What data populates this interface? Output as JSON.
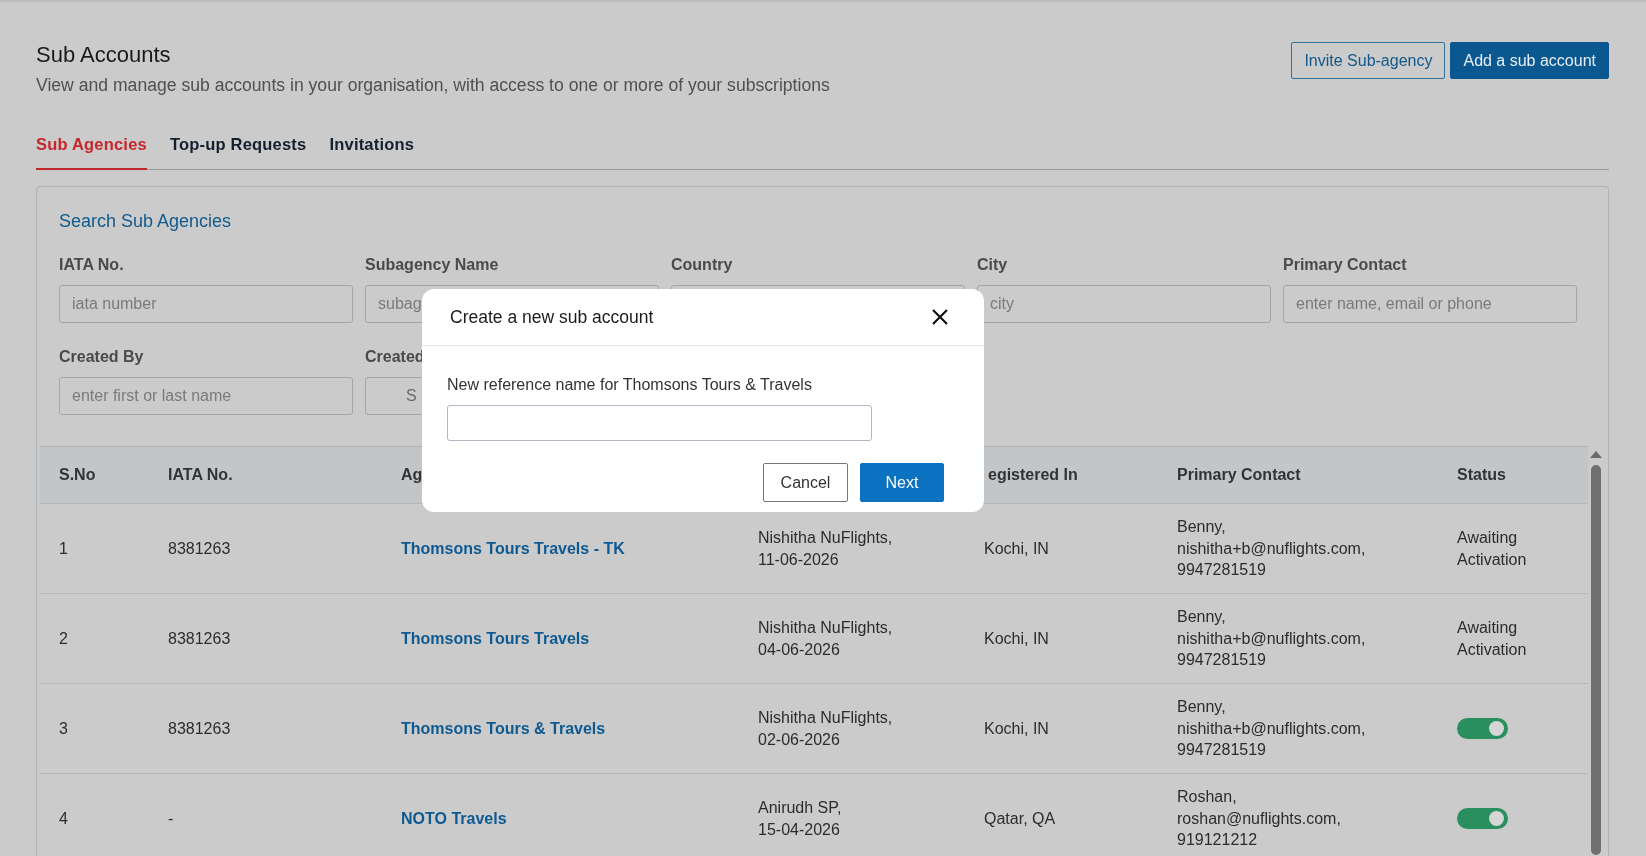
{
  "page": {
    "title": "Sub Accounts",
    "subtitle": "View and manage sub accounts in your organisation, with access to one or more of your subscriptions"
  },
  "header_buttons": [
    {
      "label": "Invite Sub-agency",
      "kind": "outline"
    },
    {
      "label": "Add a sub account",
      "kind": "primary"
    }
  ],
  "tabs": [
    {
      "label": "Sub Agencies",
      "selected": true
    },
    {
      "label": "Top-up Requests",
      "selected": false
    },
    {
      "label": "Invitations",
      "selected": false
    }
  ],
  "search": {
    "title": "Search Sub Agencies",
    "fields": [
      {
        "label": "IATA No.",
        "placeholder": "iata number"
      },
      {
        "label": "Subagency Name",
        "placeholder": "subag"
      },
      {
        "label": "Country"
      },
      {
        "label": "City",
        "placeholder": "city"
      },
      {
        "label": "Primary Contact",
        "placeholder": "enter name, email or phone"
      },
      {
        "label": "Created By",
        "placeholder": "enter first or last name"
      },
      {
        "label": "Created",
        "value": "S"
      }
    ]
  },
  "table": {
    "columns": [
      {
        "label": "S.No"
      },
      {
        "label": "IATA No."
      },
      {
        "label": "Ag"
      },
      {},
      {
        "label": "egistered In"
      },
      {
        "label": "Primary Contact"
      },
      {
        "label": "Status"
      }
    ],
    "rows": [
      {
        "sno": "1",
        "iata": "8381263",
        "agency": "Thomsons Tours Travels - TK",
        "created": "Nishitha NuFlights,\n11-06-2026",
        "registered": "Kochi, IN",
        "contact": "Benny,\nnishitha+b@nuflights.com,\n9947281519",
        "status": {
          "kind": "text",
          "label": "Awaiting\nActivation"
        }
      },
      {
        "sno": "2",
        "iata": "8381263",
        "agency": "Thomsons Tours Travels",
        "created": "Nishitha NuFlights,\n04-06-2026",
        "registered": "Kochi, IN",
        "contact": "Benny,\nnishitha+b@nuflights.com,\n9947281519",
        "status": {
          "kind": "text",
          "label": "Awaiting\nActivation"
        }
      },
      {
        "sno": "3",
        "iata": "8381263",
        "agency": "Thomsons Tours & Travels",
        "created": "Nishitha NuFlights,\n02-06-2026",
        "registered": "Kochi, IN",
        "contact": "Benny,\nnishitha+b@nuflights.com,\n9947281519",
        "status": {
          "kind": "toggle",
          "on": true
        }
      },
      {
        "sno": "4",
        "iata": "-",
        "agency": "NOTO Travels",
        "created": "Anirudh SP,\n15-04-2026",
        "registered": "Qatar, QA",
        "contact": "Roshan,\nroshan@nuflights.com,\n919121212",
        "status": {
          "kind": "toggle",
          "on": true
        }
      }
    ]
  },
  "modal": {
    "title": "Create a new sub account",
    "field_label": "New reference name for Thomsons Tours & Travels",
    "buttons": [
      {
        "label": "Cancel",
        "kind": "secondary"
      },
      {
        "label": "Next",
        "kind": "primary"
      }
    ]
  }
}
